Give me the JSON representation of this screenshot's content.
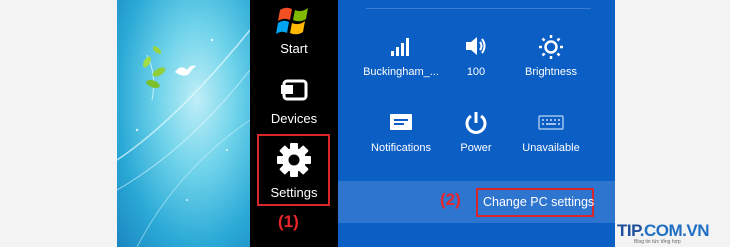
{
  "charms": [
    {
      "icon": "windows-logo-icon",
      "label": "Start"
    },
    {
      "icon": "devices-icon",
      "label": "Devices"
    },
    {
      "icon": "gear-icon",
      "label": "Settings"
    }
  ],
  "settings_tiles": [
    {
      "icon": "signal-bars-icon",
      "label": "Buckingham_..."
    },
    {
      "icon": "speaker-icon",
      "label": "100"
    },
    {
      "icon": "brightness-icon",
      "label": "Brightness"
    },
    {
      "icon": "notifications-icon",
      "label": "Notifications"
    },
    {
      "icon": "power-icon",
      "label": "Power"
    },
    {
      "icon": "keyboard-icon",
      "label": "Unavailable"
    }
  ],
  "change_pc_settings": "Change PC settings",
  "markers": {
    "one": "(1)",
    "two": "(2)"
  },
  "watermark": {
    "brand_tip": "TIP",
    "brand_rest": ".COM.VN",
    "tagline": "Blog tin tức tổng hợp"
  },
  "colors": {
    "panel": "#0b5ec4",
    "charms_bar": "#000000",
    "highlight_border": "#d9262b",
    "marker_text": "#e8252a"
  }
}
